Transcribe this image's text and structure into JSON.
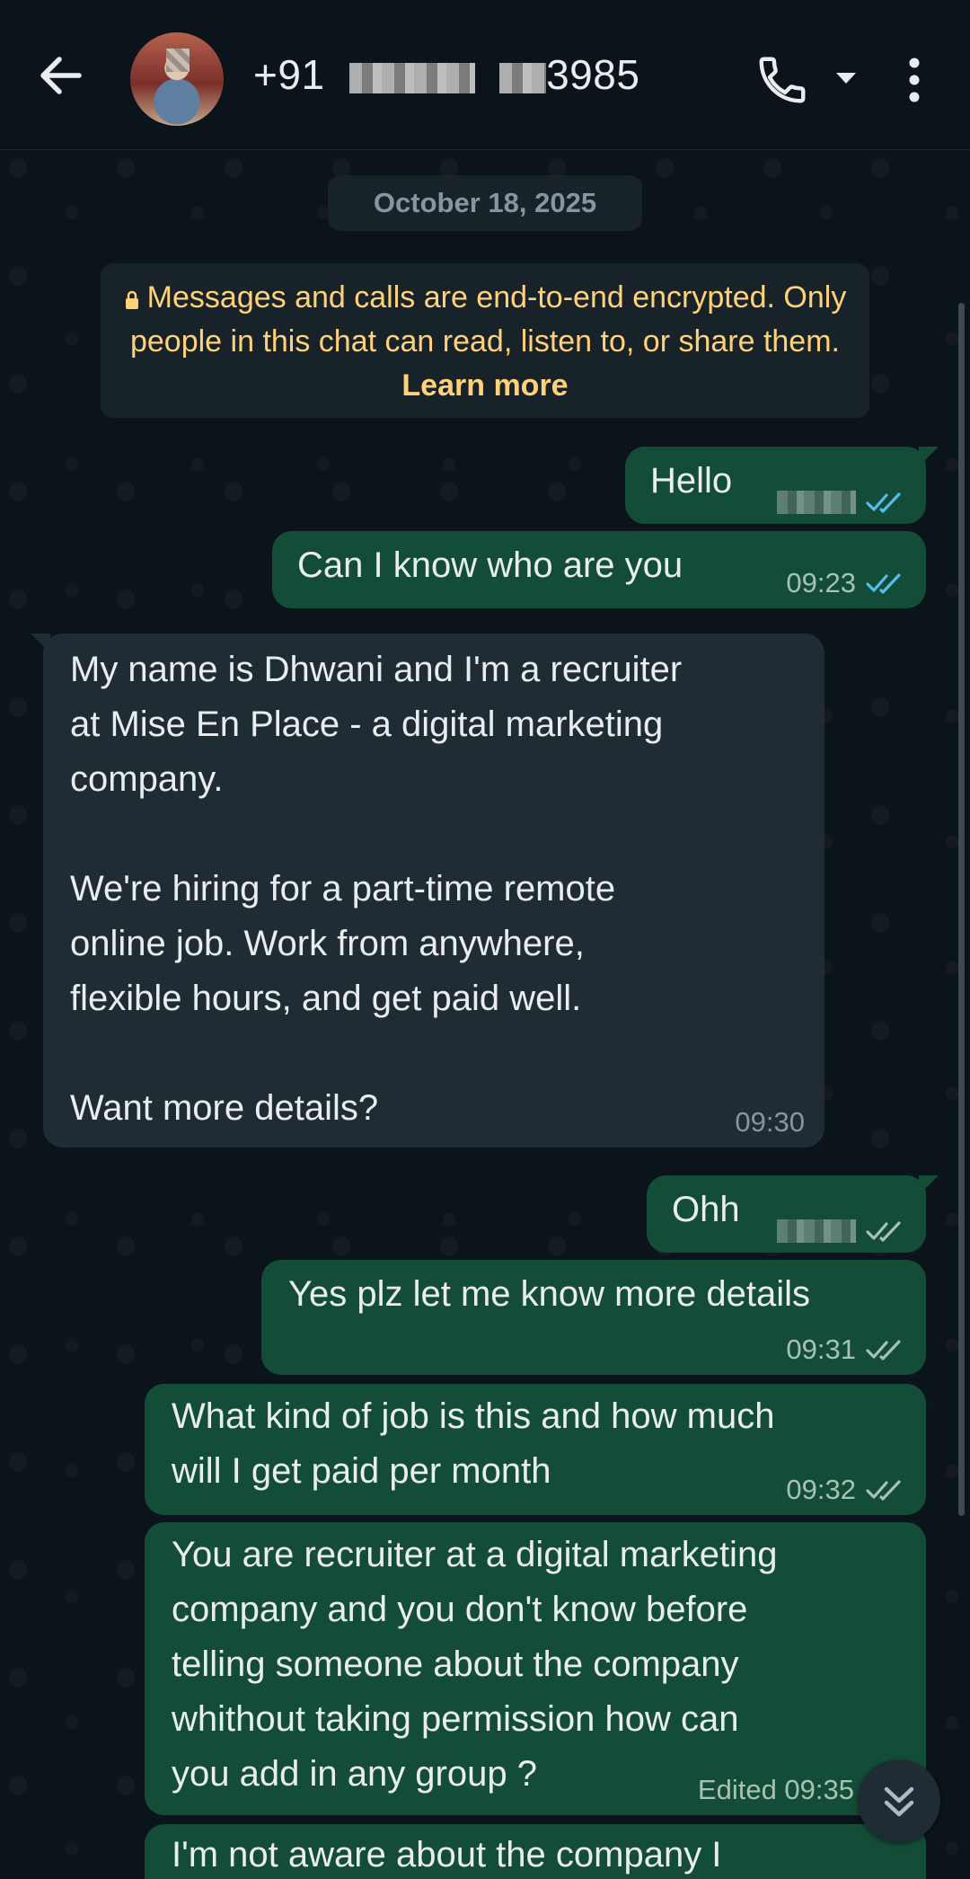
{
  "header": {
    "contact_prefix": "+91",
    "contact_suffix": "3985"
  },
  "chat": {
    "date_chip": "October 18, 2025",
    "encryption_notice": "Messages and calls are end-to-end encrypted. Only people in this chat can read, listen to, or share them.",
    "learn_more": "Learn more",
    "messages": [
      {
        "dir": "out",
        "text": "Hello",
        "time": "",
        "status": "read"
      },
      {
        "dir": "out",
        "text": "Can I know who are you",
        "time": "09:23",
        "status": "read"
      },
      {
        "dir": "in",
        "text": "My name is Dhwani and I'm a recruiter\nat Mise En Place - a digital marketing\ncompany.\n\nWe're hiring for a part-time remote\nonline job. Work from anywhere,\nflexible hours, and get paid well.\n\nWant more details?",
        "time": "09:30"
      },
      {
        "dir": "out",
        "text": "Ohh",
        "time": "",
        "status": "delivered"
      },
      {
        "dir": "out",
        "text": "Yes plz let me know more details",
        "time": "09:31",
        "status": "delivered"
      },
      {
        "dir": "out",
        "text": "What kind of job is this and how much\nwill I get paid per month",
        "time": "09:32",
        "status": "delivered"
      },
      {
        "dir": "out",
        "text": "You are recruiter at a digital marketing\ncompany and you don't know before\ntelling someone about the company\nwhithout taking permission how can\nyou add in any group ?",
        "time": "Edited 09:35",
        "status": ""
      },
      {
        "dir": "out",
        "text": "I'm not aware about the company I",
        "time": "",
        "status": ""
      }
    ]
  },
  "colors": {
    "outgoing_bubble": "#144d37",
    "incoming_bubble": "#202c33",
    "read_tick": "#53bdeb",
    "delivered_tick": "#a6c1b5",
    "encryption_text": "#ffd279"
  }
}
